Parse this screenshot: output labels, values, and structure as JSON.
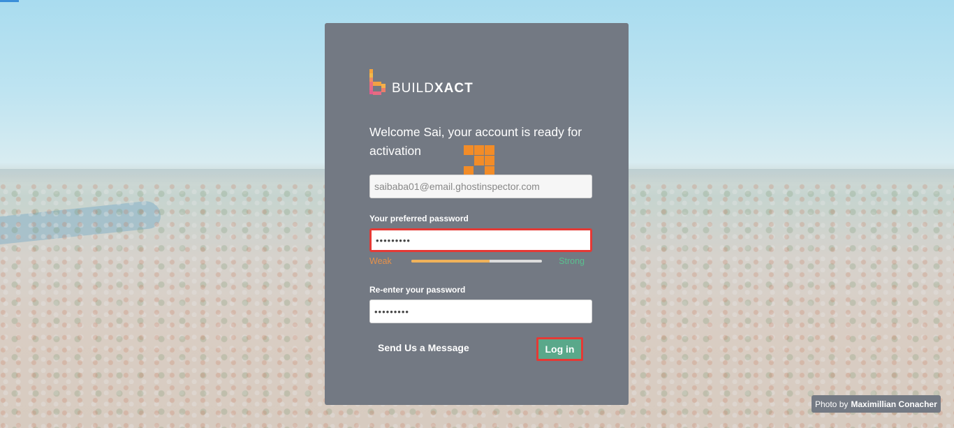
{
  "brand": {
    "name_light": "BUILD",
    "name_bold": "XACT",
    "colors": {
      "card": "#737983",
      "logo_pink": "#e56a86",
      "logo_orange": "#f4a33c",
      "accent_orange": "#f28c28",
      "weak": "#e6914a",
      "strong": "#59c08f",
      "login_button": "#5aa88a",
      "error_border": "#e53935"
    }
  },
  "welcome": {
    "text": "Welcome Sai, your account is ready for activation"
  },
  "email_field": {
    "value": "saibaba01@email.ghostinspector.com"
  },
  "password": {
    "label": "Your preferred password",
    "masked_value": "•••••••••",
    "strength": {
      "weak_label": "Weak",
      "strong_label": "Strong",
      "level_percent": 60
    }
  },
  "confirm_password": {
    "label": "Re-enter your password",
    "masked_value": "•••••••••"
  },
  "actions": {
    "send_message": "Send Us a Message",
    "login": "Log in"
  },
  "photo_credit": {
    "prefix": "Photo by",
    "author": "Maximillian Conacher"
  }
}
